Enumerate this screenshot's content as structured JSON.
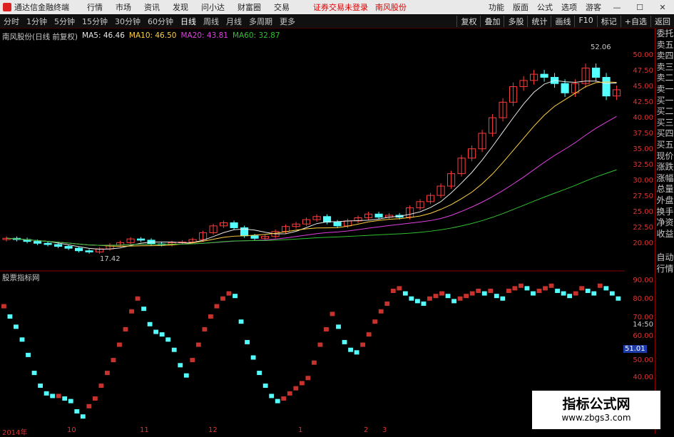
{
  "menubar": {
    "app_title": "通达信金融终端",
    "items": [
      "行情",
      "市场",
      "资讯",
      "发现",
      "问小达",
      "财富圈",
      "交易"
    ],
    "notice": "证券交易未登录",
    "stock": "南风股份",
    "right_items": [
      "功能",
      "版面",
      "公式",
      "选项"
    ],
    "user": "游客",
    "win_buttons": [
      "—",
      "☐",
      "✕"
    ]
  },
  "toolbar": {
    "periods": [
      "分时",
      "1分钟",
      "5分钟",
      "15分钟",
      "30分钟",
      "60分钟",
      "日线",
      "周线",
      "月线",
      "多周期",
      "更多"
    ],
    "active": "日线",
    "right_buttons": [
      "复权",
      "叠加",
      "多股",
      "统计",
      "画线",
      "F10",
      "标记",
      "+自选",
      "返回"
    ]
  },
  "legend": {
    "title": "南风股份(日线 前复权)",
    "ma": [
      {
        "label": "MA5: 46.46",
        "color": "#e8e8e8"
      },
      {
        "label": "MA10: 46.50",
        "color": "#ffd040"
      },
      {
        "label": "MA20: 43.81",
        "color": "#e040e0"
      },
      {
        "label": "MA60: 32.87",
        "color": "#30c030"
      }
    ]
  },
  "price_axis": [
    "50.00",
    "47.50",
    "45.00",
    "42.50",
    "40.00",
    "37.50",
    "35.00",
    "32.50",
    "30.00",
    "27.50",
    "25.00",
    "22.50",
    "20.00"
  ],
  "annotations": {
    "high": "52.06",
    "low": "17.42"
  },
  "indicator": {
    "title": "股票指标网",
    "axis": [
      "90.00",
      "80.00",
      "70.00",
      "60.00",
      "50.00",
      "40.00"
    ],
    "current": "51.01",
    "axis_repeat_label": "14:50"
  },
  "side_panel": [
    "委托",
    "卖五",
    "卖四",
    "卖三",
    "卖二",
    "卖一",
    "买一",
    "买二",
    "买三",
    "买四",
    "买五",
    "现价",
    "涨跌",
    "涨幅",
    "总量",
    "外盘",
    "换手",
    "净资",
    "收益"
  ],
  "side_panel_lower": [
    "自动",
    "行情"
  ],
  "dates": [
    "2014年",
    "10",
    "11",
    "12",
    "1",
    "2",
    "3"
  ],
  "watermark": {
    "line1": "指标公式网",
    "line2": "www.zbgs3.com"
  },
  "chart_data": {
    "type": "candlestick",
    "price_range": [
      17.42,
      52.06
    ],
    "indicator_range": [
      35,
      92
    ],
    "candles_close_approx": [
      20.6,
      20.4,
      20.1,
      19.8,
      19.6,
      19.3,
      19.0,
      18.6,
      18.4,
      18.9,
      19.5,
      19.9,
      20.5,
      20.3,
      19.7,
      19.6,
      19.9,
      20.0,
      20.4,
      21.5,
      22.6,
      23.1,
      22.3,
      21.0,
      20.6,
      20.9,
      21.7,
      22.5,
      22.9,
      23.6,
      24.1,
      23.2,
      22.6,
      23.4,
      23.9,
      24.5,
      24.0,
      24.3,
      24.0,
      25.5,
      26.5,
      27.5,
      29.0,
      31.0,
      33.5,
      35.0,
      37.5,
      40.0,
      42.5,
      45.0,
      46.0,
      47.0,
      46.5,
      45.5,
      44.0,
      45.5,
      48.0,
      46.5,
      43.5,
      44.5
    ],
    "indicator_values": [
      81,
      77,
      73,
      68,
      62,
      55,
      50,
      47,
      46,
      46,
      45,
      44,
      40,
      38,
      42,
      45,
      50,
      55,
      60,
      66,
      72,
      79,
      84,
      80,
      74,
      71,
      70,
      68,
      64,
      58,
      54,
      60,
      66,
      72,
      77,
      81,
      84,
      86,
      85,
      75,
      67,
      61,
      55,
      50,
      46,
      44,
      45,
      47,
      49,
      51,
      53,
      59,
      66,
      72,
      78,
      73,
      67,
      64,
      63,
      66,
      70,
      75,
      79,
      82,
      87,
      88,
      86,
      84,
      83,
      82,
      84,
      85,
      86,
      85,
      83,
      84,
      85,
      86,
      87,
      86,
      87,
      85,
      84,
      87,
      88,
      89,
      88,
      86,
      87,
      88,
      89,
      87,
      86,
      85,
      86,
      88,
      87,
      86,
      89,
      88,
      86,
      84
    ],
    "indicator_colors_up_down": "red rising / cyan falling"
  }
}
